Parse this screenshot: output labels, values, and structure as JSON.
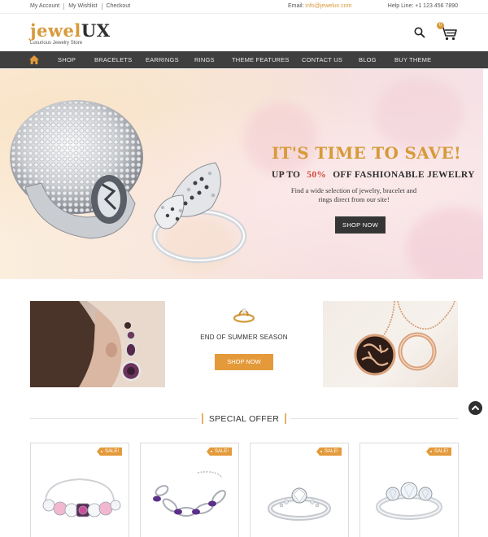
{
  "topbar": {
    "my_account": "My Account",
    "my_wishlist": "My Wishlist",
    "checkout": "Checkout",
    "email_label": "Email:",
    "email_value": "info@jewelux.com",
    "helpline": "Help Line: +1 123 456 7890"
  },
  "header": {
    "logo_part1": "jewel",
    "logo_part2": "UX",
    "tagline": "Luxurious Jewelry Store",
    "cart_count": "0",
    "search_icon": "search-icon",
    "cart_icon": "cart-icon"
  },
  "nav": {
    "home_icon": "home-icon",
    "items": [
      "SHOP",
      "BRACELETS",
      "EARRINGS",
      "RINGS",
      "THEME FEATURES",
      "CONTACT US",
      "BLOG",
      "BUY THEME"
    ]
  },
  "hero": {
    "title": "IT'S TIME TO SAVE!",
    "sub_prefix": "UP TO",
    "sub_percent": "50%",
    "sub_suffix": "OFF FASHIONABLE JEWELRY",
    "description": "Find a wide selection of jewelry, bracelet and rings direct from our site!",
    "button": "SHOP NOW"
  },
  "promo": {
    "title": "END OF SUMMER SEASON",
    "button": "SHOP NOW"
  },
  "special_offer": {
    "heading": "SPECIAL OFFER",
    "products": [
      {
        "badge": "SALE!",
        "kind": "bracelet-pink"
      },
      {
        "badge": "SALE!",
        "kind": "bracelet-purple"
      },
      {
        "badge": "SALE!",
        "kind": "ring-diamond"
      },
      {
        "badge": "SALE!",
        "kind": "ring-three-stone"
      }
    ]
  },
  "scroll_top_icon": "chevron-up-icon",
  "colors": {
    "accent": "#d79a3a",
    "button_orange": "#e49a3a",
    "nav_bg": "#3f3f3f",
    "dark_button": "#353535",
    "percent_red": "#d34a3b"
  }
}
